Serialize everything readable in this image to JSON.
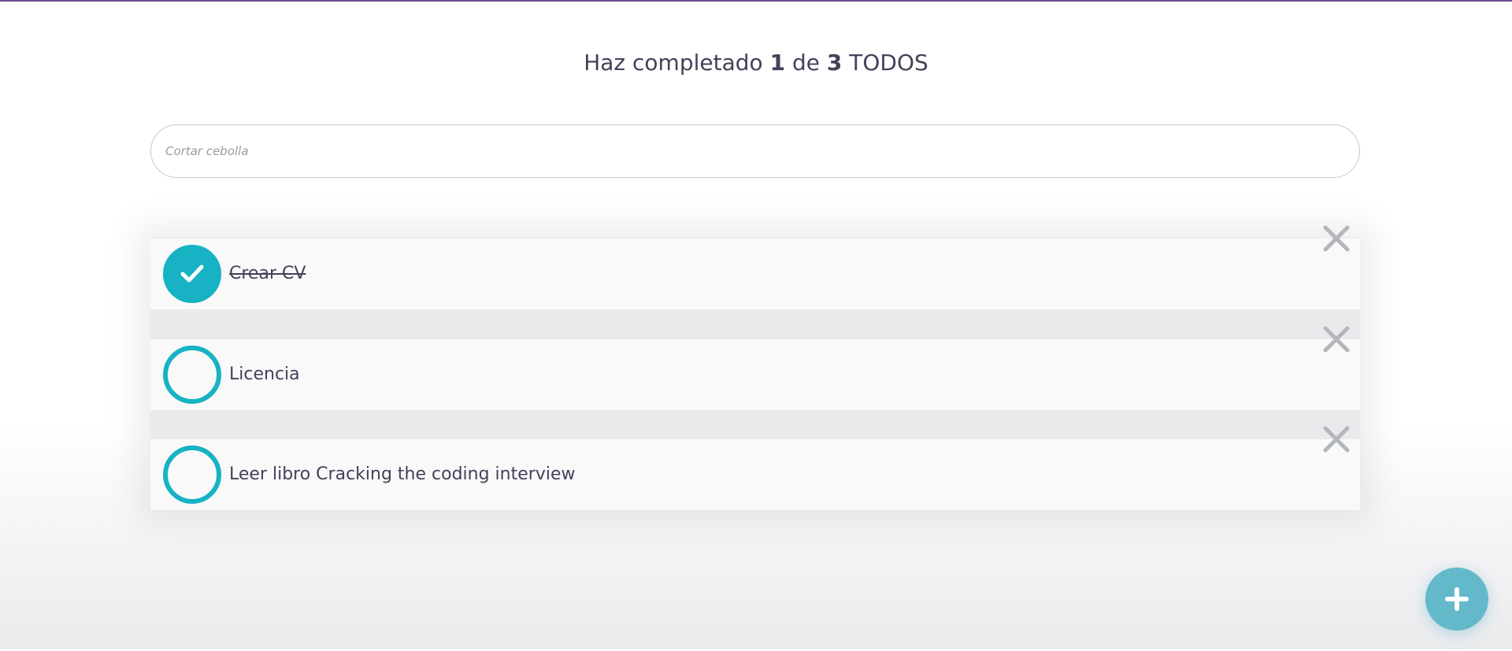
{
  "header": {
    "title_prefix": "Haz completado",
    "completed_count": "1",
    "title_middle": "de",
    "total_count": "3",
    "title_suffix": "TODOS"
  },
  "input": {
    "placeholder": "Cortar cebolla",
    "value": ""
  },
  "todos": [
    {
      "label": "Crear CV",
      "completed": true
    },
    {
      "label": "Licencia",
      "completed": false
    },
    {
      "label": "Leer libro Cracking the coding interview",
      "completed": false
    }
  ],
  "icons": {
    "check": "check-icon",
    "delete": "close-icon",
    "add": "plus-icon"
  },
  "colors": {
    "accent": "#17b3c4",
    "fab": "#63b9ca",
    "text": "#43425a",
    "delete_icon": "#b3b6bb",
    "top_bar": "#6a4a86"
  }
}
